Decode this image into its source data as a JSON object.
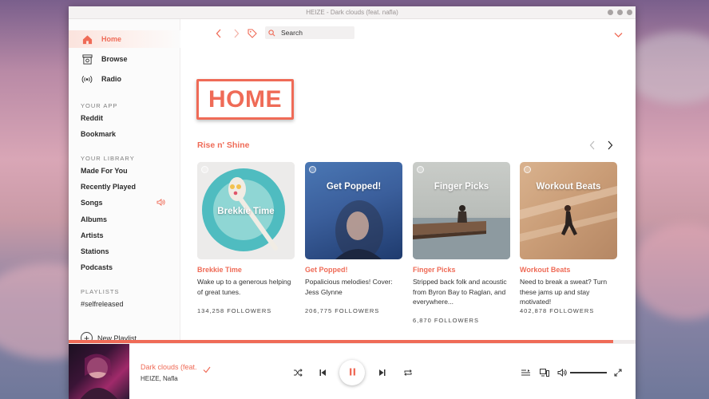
{
  "window": {
    "title": "HEIZE - Dark clouds (feat. nafla)"
  },
  "sidebar": {
    "nav": [
      {
        "label": "Home",
        "icon": "home-icon",
        "active": true
      },
      {
        "label": "Browse",
        "icon": "browse-icon",
        "active": false
      },
      {
        "label": "Radio",
        "icon": "radio-icon",
        "active": false
      }
    ],
    "your_app": {
      "title": "YOUR APP",
      "items": [
        "Reddit",
        "Bookmark"
      ]
    },
    "your_library": {
      "title": "YOUR LIBRARY",
      "items": [
        "Made For You",
        "Recently Played",
        "Songs",
        "Albums",
        "Artists",
        "Stations",
        "Podcasts"
      ]
    },
    "playlists": {
      "title": "PLAYLISTS",
      "items": [
        "#selfreleased"
      ]
    },
    "new_playlist": "New Playlist"
  },
  "topbar": {
    "search_placeholder": "Search"
  },
  "main": {
    "heading": "HOME",
    "row_title": "Rise n' Shine",
    "cards": [
      {
        "art_caption": "Brekkie Time",
        "title": "Brekkie Time",
        "desc": "Wake up to a generous helping of great tunes.",
        "followers": "134,258 FOLLOWERS"
      },
      {
        "art_caption": "Get Popped!",
        "title": "Get Popped!",
        "desc": "Popalicious melodies! Cover: Jess Glynne",
        "followers": "206,775 FOLLOWERS"
      },
      {
        "art_caption": "Finger Picks",
        "title": "Finger Picks",
        "desc": "Stripped back folk and acoustic from Byron Bay to Raglan, and everywhere...",
        "followers": "6,870 FOLLOWERS"
      },
      {
        "art_caption": "Workout Beats",
        "title": "Workout Beats",
        "desc": "Need to break a sweat? Turn these jams up and stay motivated!",
        "followers": "402,878 FOLLOWERS"
      }
    ]
  },
  "player": {
    "track_title": "Dark clouds (feat.",
    "artist": "HEIZE, Nafla",
    "progress": 0.96
  },
  "colors": {
    "accent": "#ef6b57"
  }
}
